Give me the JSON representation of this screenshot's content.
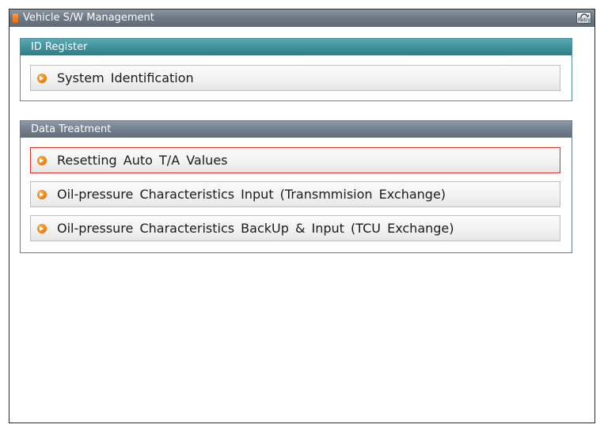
{
  "window": {
    "title": "Vehicle S/W Management",
    "retry_label": "Retry"
  },
  "id_register": {
    "header": "ID Register",
    "items": [
      {
        "label": "System Identification"
      }
    ]
  },
  "data_treatment": {
    "header": "Data Treatment",
    "selected_index": 0,
    "items": [
      {
        "label": "Resetting Auto T/A Values"
      },
      {
        "label": "Oil-pressure Characteristics Input (Transmmision Exchange)"
      },
      {
        "label": "Oil-pressure Characteristics BackUp & Input (TCU Exchange)"
      }
    ]
  },
  "colors": {
    "title_bar": "#6d7885",
    "id_register_header": "#3f8f9b",
    "data_treatment_header": "#717d8b",
    "selection_border": "#e0322a",
    "bullet": "#f08414"
  },
  "icons": {
    "title": "vehicle-tag-icon",
    "retry": "retry-icon",
    "bullet": "orange-arrow-bullet-icon"
  }
}
